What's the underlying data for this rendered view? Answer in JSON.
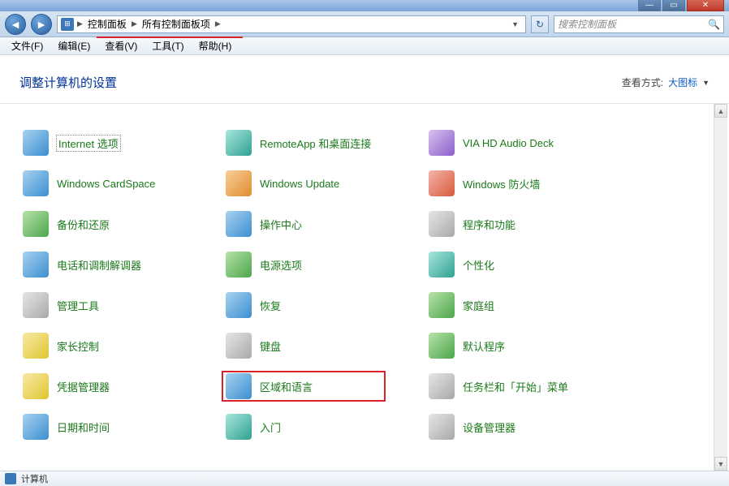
{
  "window": {
    "buttons": {
      "min": "—",
      "max": "▭",
      "close": "✕"
    }
  },
  "nav": {
    "back": "◄",
    "forward": "►",
    "crumbs": [
      "控制面板",
      "所有控制面板项"
    ],
    "sep": "▶",
    "dropdown": "▼",
    "refresh": "↻",
    "search_placeholder": "搜索控制面板",
    "search_icon": "🔍"
  },
  "menu": {
    "file": "文件(F)",
    "edit": "编辑(E)",
    "view": "查看(V)",
    "tools": "工具(T)",
    "help": "帮助(H)"
  },
  "header": {
    "title": "调整计算机的设置",
    "viewby_label": "查看方式:",
    "viewby_value": "大图标",
    "drop": "▼"
  },
  "items": [
    {
      "label": "Internet 选项",
      "slug": "internet-options",
      "ic": "g-blue"
    },
    {
      "label": "RemoteApp 和桌面连接",
      "slug": "remoteapp",
      "ic": "g-teal"
    },
    {
      "label": "VIA HD Audio Deck",
      "slug": "via-audio",
      "ic": "g-purple"
    },
    {
      "label": "Windows CardSpace",
      "slug": "cardspace",
      "ic": "g-blue"
    },
    {
      "label": "Windows Update",
      "slug": "windows-update",
      "ic": "g-orange"
    },
    {
      "label": "Windows 防火墙",
      "slug": "firewall",
      "ic": "g-red"
    },
    {
      "label": "备份和还原",
      "slug": "backup",
      "ic": "g-green"
    },
    {
      "label": "操作中心",
      "slug": "action-center",
      "ic": "g-blue"
    },
    {
      "label": "程序和功能",
      "slug": "programs",
      "ic": "g-gray"
    },
    {
      "label": "电话和调制解调器",
      "slug": "phone-modem",
      "ic": "g-blue"
    },
    {
      "label": "电源选项",
      "slug": "power",
      "ic": "g-green"
    },
    {
      "label": "个性化",
      "slug": "personalization",
      "ic": "g-teal"
    },
    {
      "label": "管理工具",
      "slug": "admin-tools",
      "ic": "g-gray"
    },
    {
      "label": "恢复",
      "slug": "recovery",
      "ic": "g-blue"
    },
    {
      "label": "家庭组",
      "slug": "homegroup",
      "ic": "g-green"
    },
    {
      "label": "家长控制",
      "slug": "parental",
      "ic": "g-yel"
    },
    {
      "label": "键盘",
      "slug": "keyboard",
      "ic": "g-gray"
    },
    {
      "label": "默认程序",
      "slug": "default-programs",
      "ic": "g-green"
    },
    {
      "label": "凭据管理器",
      "slug": "credentials",
      "ic": "g-yel"
    },
    {
      "label": "区域和语言",
      "slug": "region-language",
      "ic": "g-blue",
      "highlight": true
    },
    {
      "label": "任务栏和「开始」菜单",
      "slug": "taskbar",
      "ic": "g-gray"
    },
    {
      "label": "日期和时间",
      "slug": "datetime",
      "ic": "g-blue"
    },
    {
      "label": "入门",
      "slug": "getting-started",
      "ic": "g-teal"
    },
    {
      "label": "设备管理器",
      "slug": "device-manager",
      "ic": "g-gray"
    }
  ],
  "status": {
    "text": "计算机"
  },
  "scroll": {
    "up": "▲",
    "down": "▼"
  }
}
